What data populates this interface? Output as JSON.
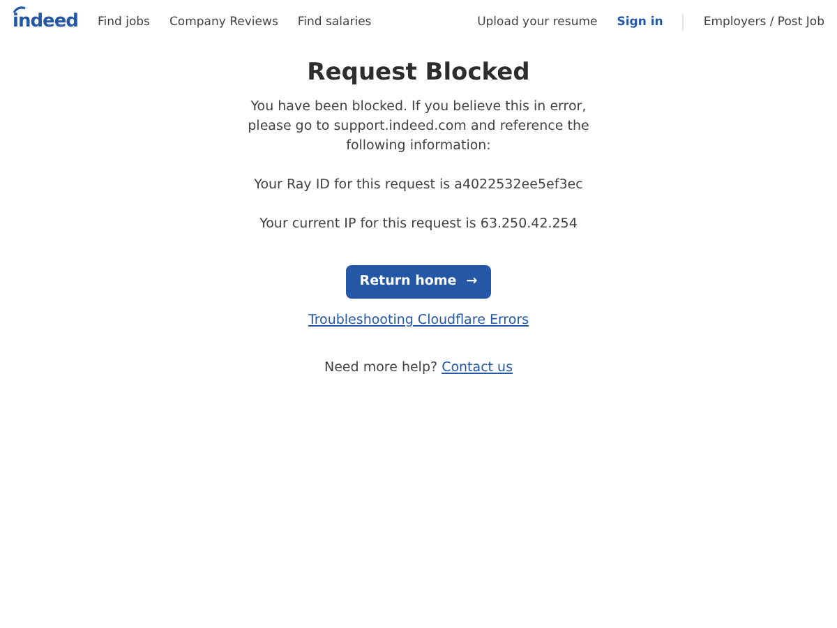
{
  "header": {
    "logo": "indeed",
    "nav": [
      "Find jobs",
      "Company Reviews",
      "Find salaries"
    ],
    "right": [
      {
        "label": "Upload your resume",
        "kind": "link"
      },
      {
        "label": "Sign in",
        "kind": "primary"
      },
      {
        "label": "Employers / Post Job",
        "kind": "divided"
      }
    ]
  },
  "main": {
    "title": "Request Blocked",
    "message": "You have been blocked. If you believe this in error, please go to support.indeed.com and reference the following information:",
    "ray_id": "Your Ray ID for this request is a4022532ee5ef3ec",
    "ip": "Your current IP for this request is 63.250.42.254",
    "button": {
      "label": "Return home",
      "arrow": "→"
    },
    "troubleshooting_link": "Troubleshooting Cloudflare Errors",
    "help": {
      "text": "Need more help?",
      "link": "Contact us"
    }
  }
}
